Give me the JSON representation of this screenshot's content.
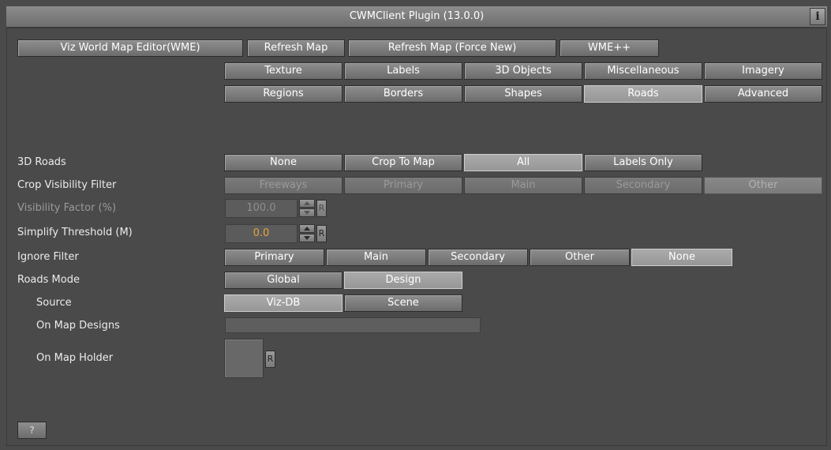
{
  "window": {
    "title": "CWMClient Plugin (13.0.0)",
    "info_label": "i"
  },
  "top_buttons": [
    "Viz World Map Editor(WME)",
    "Refresh Map",
    "Refresh Map (Force New)",
    "WME++"
  ],
  "tabs_row1": [
    "Texture",
    "Labels",
    "3D Objects",
    "Miscellaneous",
    "Imagery"
  ],
  "tabs_row2": [
    "Regions",
    "Borders",
    "Shapes",
    "Roads",
    "Advanced"
  ],
  "roads3d": {
    "label": "3D Roads",
    "options": [
      "None",
      "Crop To Map",
      "All",
      "Labels Only"
    ],
    "selected": "All"
  },
  "crop_filter": {
    "label": "Crop Visibility  Filter",
    "options": [
      "Freeways",
      "Primary",
      "Main",
      "Secondary",
      "Other"
    ],
    "selected": "Other"
  },
  "visibility_factor": {
    "label": "Visibility Factor (%)",
    "value": "100.0",
    "reset": "R"
  },
  "simplify": {
    "label": "Simplify Threshold (M)",
    "value": "0.0",
    "reset": "R",
    "value_color": "#e6a540"
  },
  "ignore_filter": {
    "label": "Ignore Filter",
    "options": [
      "Primary",
      "Main",
      "Secondary",
      "Other",
      "None"
    ],
    "selected": "None"
  },
  "roads_mode": {
    "label": "Roads Mode",
    "options": [
      "Global",
      "Design"
    ],
    "selected": "Design"
  },
  "source": {
    "label": "Source",
    "options": [
      "Viz-DB",
      "Scene"
    ],
    "selected": "Viz-DB"
  },
  "on_map_designs": {
    "label": "On Map Designs",
    "value": ""
  },
  "on_map_holder": {
    "label": "On Map Holder",
    "reset": "R"
  },
  "help": {
    "label": "?"
  }
}
